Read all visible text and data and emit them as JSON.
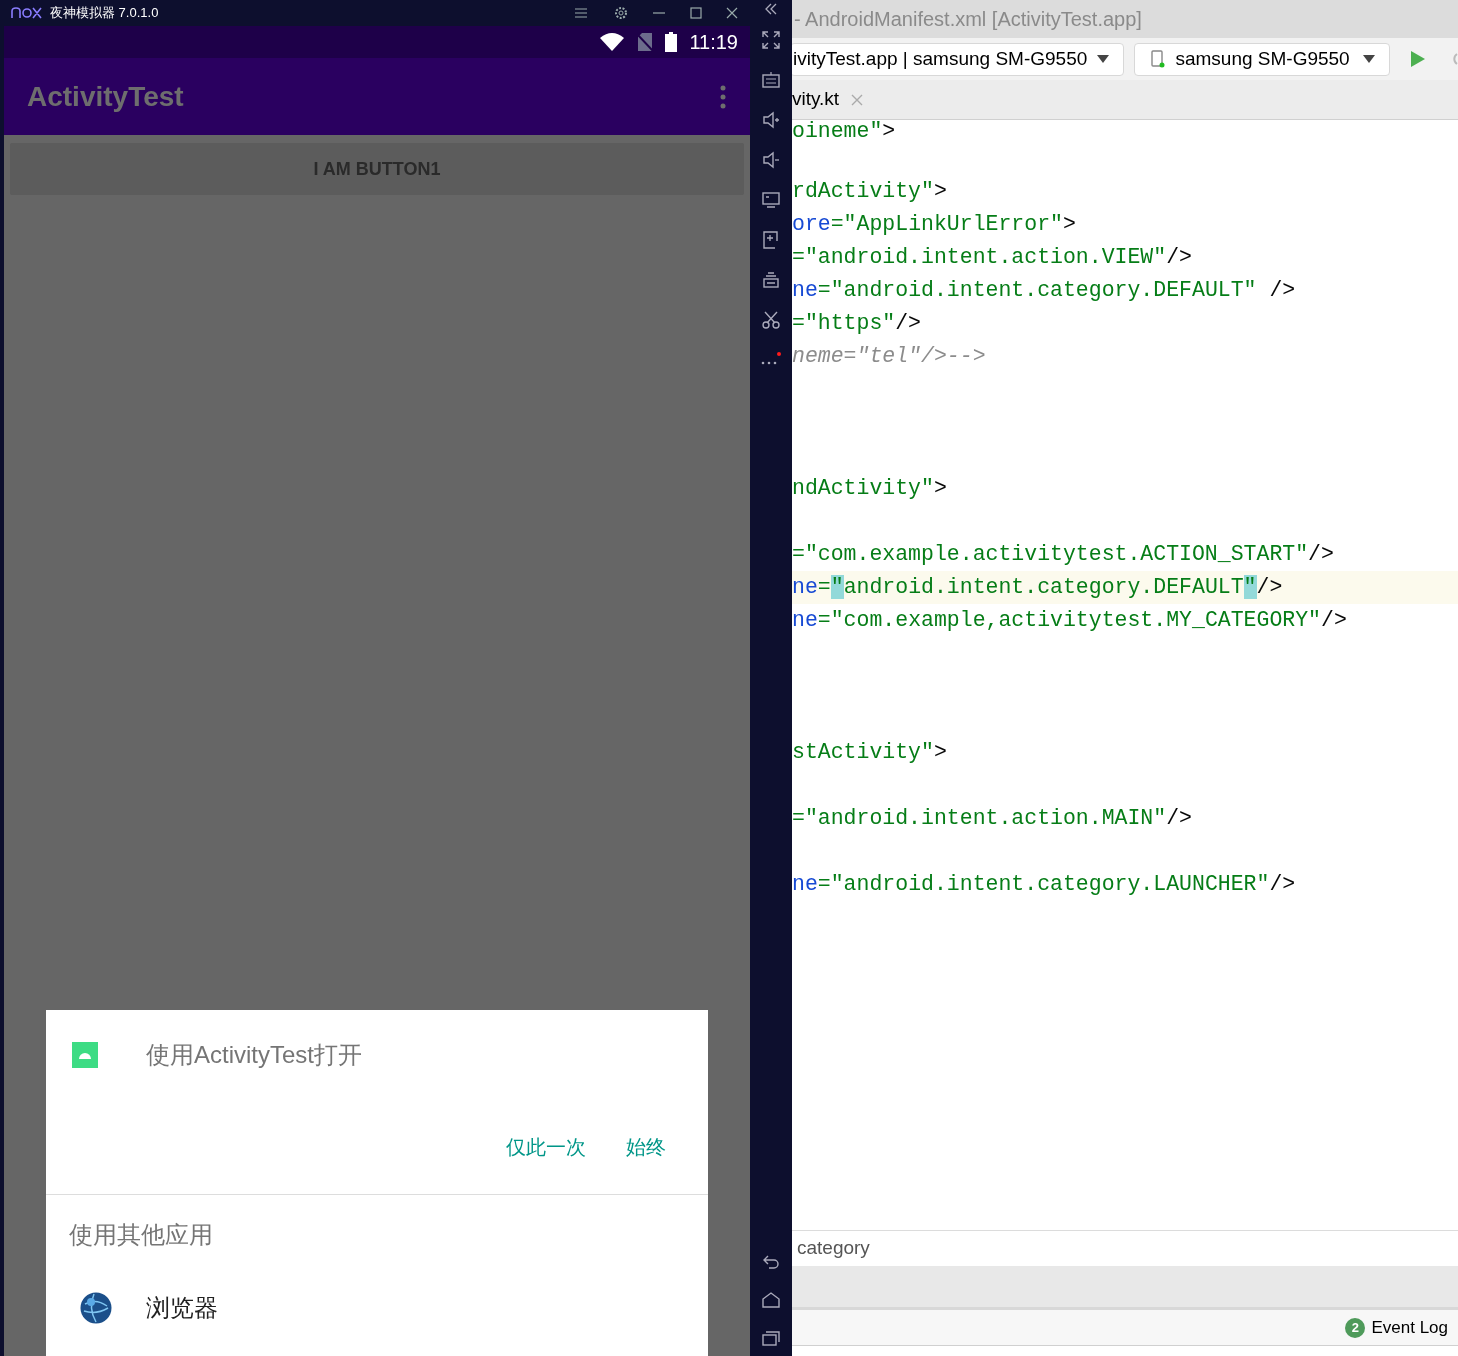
{
  "emulator": {
    "title": "夜神模拟器 7.0.1.0",
    "status_bar": {
      "time": "11:19"
    },
    "app_bar": {
      "title": "ActivityTest"
    },
    "button": "I AM BUTTON1",
    "dialog": {
      "title": "使用ActivityTest打开",
      "actions": [
        "仅此一次",
        "始终"
      ],
      "section": "使用其他应用",
      "apps": [
        {
          "label": "浏览器"
        }
      ]
    }
  },
  "ide": {
    "title": "- AndroidManifest.xml [ActivityTest.app]",
    "run_config": "ivityTest.app | samsung SM-G9550",
    "device": "samsung SM-G9550",
    "tabs": [
      {
        "label": "vity.kt"
      }
    ],
    "editor": {
      "lines": [
        {
          "kind": "code",
          "current": false,
          "segments": [
            {
              "kind": "str",
              "text": "oineme\""
            },
            {
              "kind": "punct",
              "text": ">"
            }
          ]
        },
        {
          "kind": "blank"
        },
        {
          "kind": "code",
          "current": false,
          "segments": [
            {
              "kind": "str",
              "text": "rdActivity\""
            },
            {
              "kind": "punct",
              "text": ">"
            }
          ]
        },
        {
          "kind": "code",
          "current": false,
          "segments": [
            {
              "kind": "attr",
              "text": "ore"
            },
            {
              "kind": "str",
              "text": "=\"AppLinkUrlError\""
            },
            {
              "kind": "punct",
              "text": ">"
            }
          ]
        },
        {
          "kind": "code",
          "current": false,
          "segments": [
            {
              "kind": "str",
              "text": "=\"android.intent.action.VIEW\""
            },
            {
              "kind": "punct",
              "text": "/>"
            }
          ]
        },
        {
          "kind": "code",
          "current": false,
          "segments": [
            {
              "kind": "attr",
              "text": "ne"
            },
            {
              "kind": "str",
              "text": "=\"android.intent.category.DEFAULT\""
            },
            {
              "kind": "punct",
              "text": " />"
            }
          ]
        },
        {
          "kind": "code",
          "current": false,
          "segments": [
            {
              "kind": "str",
              "text": "=\"https\""
            },
            {
              "kind": "punct",
              "text": "/>"
            }
          ]
        },
        {
          "kind": "code",
          "current": false,
          "segments": [
            {
              "kind": "comment",
              "text": "neme=\"tel\"/>-->"
            }
          ]
        },
        {
          "kind": "blank"
        },
        {
          "kind": "blank"
        },
        {
          "kind": "blank"
        },
        {
          "kind": "code",
          "current": false,
          "segments": [
            {
              "kind": "str",
              "text": "ndActivity\""
            },
            {
              "kind": "punct",
              "text": ">"
            }
          ]
        },
        {
          "kind": "blank"
        },
        {
          "kind": "code",
          "current": false,
          "segments": [
            {
              "kind": "str",
              "text": "=\"com.example.activitytest.ACTION_START\""
            },
            {
              "kind": "punct",
              "text": "/>"
            }
          ]
        },
        {
          "kind": "code",
          "current": true,
          "segments": [
            {
              "kind": "attr",
              "text": "ne"
            },
            {
              "kind": "str",
              "text": "="
            },
            {
              "kind": "match",
              "text": "\""
            },
            {
              "kind": "str",
              "text": "android.intent.category.DEFAULT"
            },
            {
              "kind": "match",
              "text": "\""
            },
            {
              "kind": "punct",
              "text": "/>"
            }
          ]
        },
        {
          "kind": "code",
          "current": false,
          "segments": [
            {
              "kind": "attr",
              "text": "ne"
            },
            {
              "kind": "str",
              "text": "=\"com.example,activitytest.MY_CATEGORY\""
            },
            {
              "kind": "punct",
              "text": "/>"
            }
          ]
        },
        {
          "kind": "blank"
        },
        {
          "kind": "blank"
        },
        {
          "kind": "blank"
        },
        {
          "kind": "code",
          "current": false,
          "segments": [
            {
              "kind": "str",
              "text": "stActivity\""
            },
            {
              "kind": "punct",
              "text": ">"
            }
          ]
        },
        {
          "kind": "blank"
        },
        {
          "kind": "code",
          "current": false,
          "segments": [
            {
              "kind": "str",
              "text": "=\"android.intent.action.MAIN\""
            },
            {
              "kind": "punct",
              "text": "/>"
            }
          ]
        },
        {
          "kind": "blank"
        },
        {
          "kind": "code",
          "current": false,
          "segments": [
            {
              "kind": "attr",
              "text": "ne"
            },
            {
              "kind": "str",
              "text": "=\"android.intent.category.LAUNCHER\""
            },
            {
              "kind": "punct",
              "text": "/>"
            }
          ]
        }
      ]
    },
    "find_bar": {
      "value": "category"
    },
    "status_bar": {
      "event_log": {
        "count": "2",
        "label": "Event Log"
      }
    }
  }
}
